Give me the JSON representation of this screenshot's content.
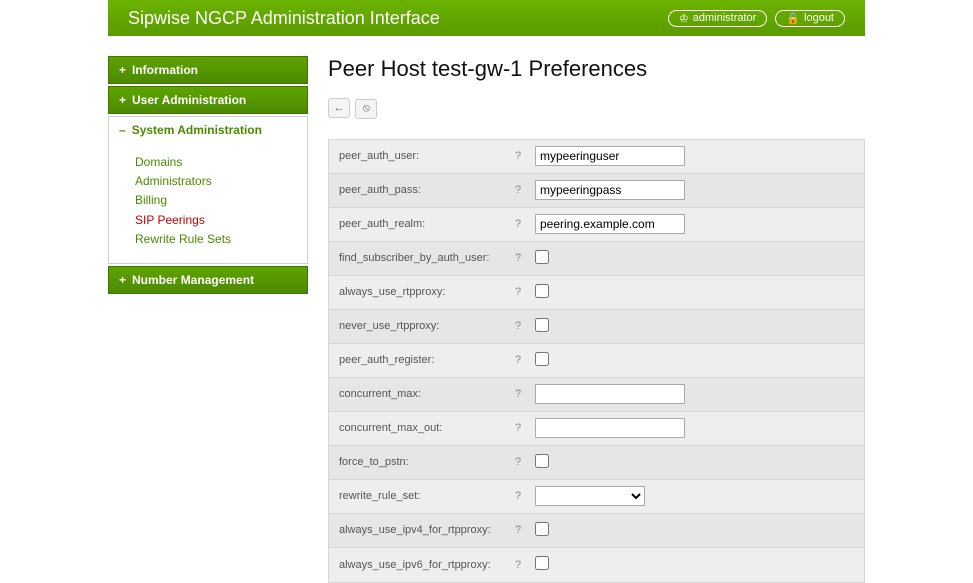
{
  "header": {
    "title": "Sipwise NGCP Administration Interface",
    "user_label": "administrator",
    "logout_label": "logout"
  },
  "sidebar": {
    "sections": [
      {
        "label": "Information",
        "expanded": false
      },
      {
        "label": "User Administration",
        "expanded": false
      },
      {
        "label": "System Administration",
        "expanded": true,
        "items": [
          {
            "label": "Domains",
            "active": false
          },
          {
            "label": "Administrators",
            "active": false
          },
          {
            "label": "Billing",
            "active": false
          },
          {
            "label": "SIP Peerings",
            "active": true
          },
          {
            "label": "Rewrite Rule Sets",
            "active": false
          }
        ]
      },
      {
        "label": "Number Management",
        "expanded": false
      }
    ]
  },
  "page": {
    "title": "Peer Host test-gw-1 Preferences",
    "back_icon": "←",
    "clear_icon": "⦸"
  },
  "prefs": [
    {
      "key": "peer_auth_user",
      "type": "text",
      "value": "mypeeringuser"
    },
    {
      "key": "peer_auth_pass",
      "type": "text",
      "value": "mypeeringpass"
    },
    {
      "key": "peer_auth_realm",
      "type": "text",
      "value": "peering.example.com"
    },
    {
      "key": "find_subscriber_by_auth_user",
      "type": "checkbox",
      "value": false
    },
    {
      "key": "always_use_rtpproxy",
      "type": "checkbox",
      "value": false
    },
    {
      "key": "never_use_rtpproxy",
      "type": "checkbox",
      "value": false
    },
    {
      "key": "peer_auth_register",
      "type": "checkbox",
      "value": false
    },
    {
      "key": "concurrent_max",
      "type": "text",
      "value": ""
    },
    {
      "key": "concurrent_max_out",
      "type": "text",
      "value": ""
    },
    {
      "key": "force_to_pstn",
      "type": "checkbox",
      "value": false
    },
    {
      "key": "rewrite_rule_set",
      "type": "select",
      "value": ""
    },
    {
      "key": "always_use_ipv4_for_rtpproxy",
      "type": "checkbox",
      "value": false
    },
    {
      "key": "always_use_ipv6_for_rtpproxy",
      "type": "checkbox",
      "value": false
    }
  ],
  "help_symbol": "?"
}
